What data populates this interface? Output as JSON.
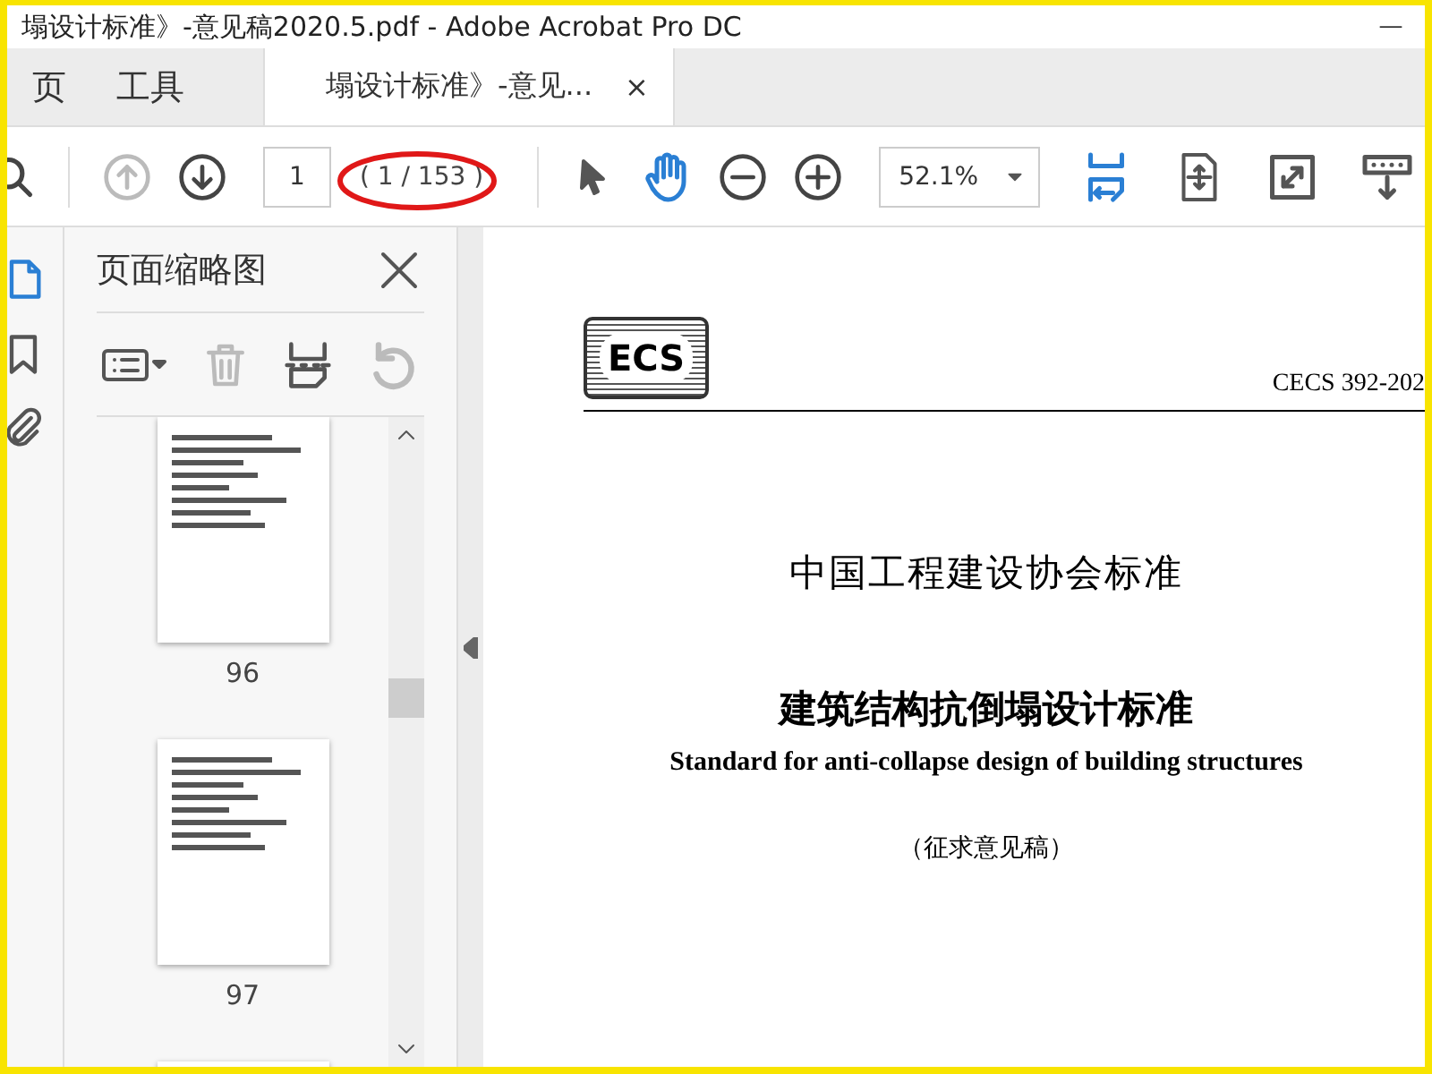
{
  "window": {
    "title": "塌设计标准》-意见稿2020.5.pdf - Adobe Acrobat Pro DC"
  },
  "tabs": [
    {
      "label": "页",
      "kind": "plain",
      "selected": false
    },
    {
      "label": "工具",
      "kind": "plain",
      "selected": false
    },
    {
      "label": "塌设计标准》-意见...",
      "kind": "document",
      "selected": true,
      "close": "×"
    }
  ],
  "toolbar": {
    "prev_page": {
      "disabled": true
    },
    "next_page": {
      "disabled": false
    },
    "page_field": {
      "value": "1"
    },
    "page_count": "( 1 / 153 )",
    "page_count_circled": true,
    "tools": [
      {
        "kind": "pointer",
        "selected": false
      },
      {
        "kind": "hand",
        "selected": true
      }
    ],
    "zoom": {
      "value": "52.1%"
    },
    "fit_width": {
      "selected": true
    }
  },
  "rail": [
    {
      "kind": "pages",
      "selected": true
    },
    {
      "kind": "bookmark",
      "selected": false
    },
    {
      "kind": "attach",
      "selected": false
    }
  ],
  "panel": {
    "title": "页面缩略图",
    "tools": [
      {
        "kind": "options",
        "disabled": false
      },
      {
        "kind": "delete",
        "disabled": true
      },
      {
        "kind": "insert",
        "disabled": false
      },
      {
        "kind": "rotate",
        "disabled": true
      }
    ],
    "thumbnails": [
      {
        "label": "96",
        "selected": false
      },
      {
        "label": "97",
        "selected": false
      },
      {
        "selected": false
      }
    ]
  },
  "document": {
    "logo": "ECS",
    "code": "CECS 392-202",
    "org": "中国工程建设协会标准",
    "title": "建筑结构抗倒塌设计标准",
    "subtitle": "Standard for anti-collapse design of building structures",
    "note": "（征求意见稿）"
  }
}
